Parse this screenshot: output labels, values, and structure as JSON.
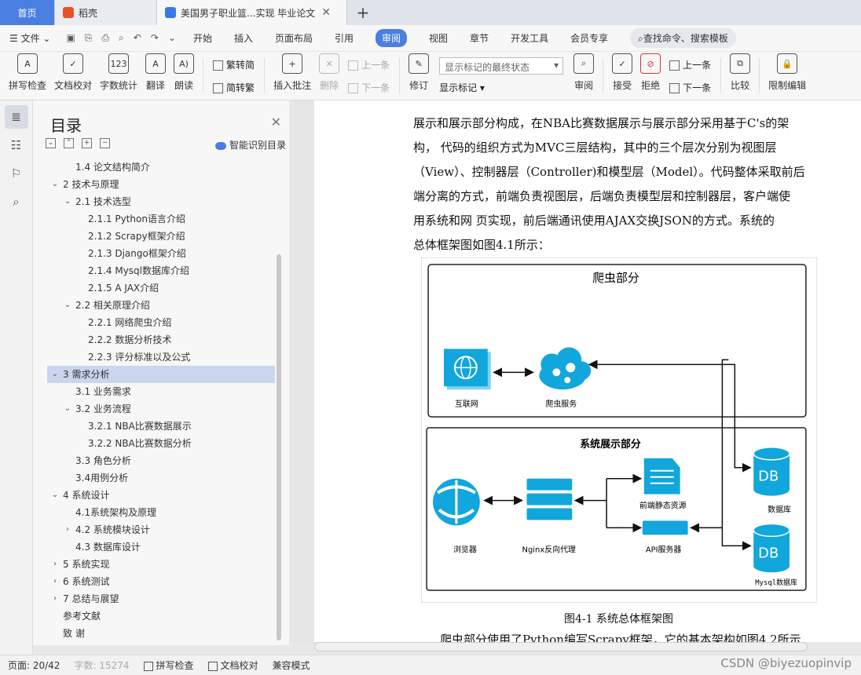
{
  "tabs": {
    "home": "首页",
    "wps": "稻壳",
    "doc": "美国男子职业篮...实现 毕业论文",
    "close": "✕",
    "new": "+"
  },
  "menu": {
    "file": "文件",
    "items": [
      "开始",
      "插入",
      "页面布局",
      "引用",
      "审阅",
      "视图",
      "章节",
      "开发工具",
      "会员专享"
    ],
    "active": "审阅",
    "search": "查找命令、搜索模板"
  },
  "ribbon": {
    "spell": "拼写检查",
    "proof": "文档校对",
    "wordcount": "字数统计",
    "translate": "翻译",
    "read": "朗读",
    "trad": "繁转简",
    "simp": "简转繁",
    "insert_comment": "插入批注",
    "delete": "删除",
    "prev": "上一条",
    "next": "下一条",
    "revise": "修订",
    "markstate": "显示标记的最终状态",
    "showmark": "显示标记",
    "review": "审阅",
    "accept": "接受",
    "reject": "拒绝",
    "prev2": "上一条",
    "next2": "下一条",
    "compare": "比较",
    "restrict": "限制编辑"
  },
  "toc": {
    "title": "目录",
    "smart": "智能识别目录",
    "items": [
      {
        "t": "1.4 论文结构简介",
        "lvl": 2
      },
      {
        "t": "2 技术与原理",
        "lvl": 1,
        "car": "v"
      },
      {
        "t": "2.1 技术选型",
        "lvl": 2,
        "car": "v"
      },
      {
        "t": "2.1.1 Python语言介绍",
        "lvl": 3
      },
      {
        "t": "2.1.2 Scrapy框架介绍",
        "lvl": 3
      },
      {
        "t": "2.1.3 Django框架介绍",
        "lvl": 3
      },
      {
        "t": "2.1.4 Mysql数据库介绍",
        "lvl": 3
      },
      {
        "t": "2.1.5 A JAX介绍",
        "lvl": 3
      },
      {
        "t": "2.2 相关原理介绍",
        "lvl": 2,
        "car": "v"
      },
      {
        "t": "2.2.1 网络爬虫介绍",
        "lvl": 3
      },
      {
        "t": "2.2.2 数据分析技术",
        "lvl": 3
      },
      {
        "t": "2.2.3 评分标准以及公式",
        "lvl": 3
      },
      {
        "t": "3 需求分析",
        "lvl": 1,
        "car": "v",
        "sel": true
      },
      {
        "t": "3.1 业务需求",
        "lvl": 2
      },
      {
        "t": "3.2 业务流程",
        "lvl": 2,
        "car": "v"
      },
      {
        "t": "3.2.1 NBA比赛数据展示",
        "lvl": 3
      },
      {
        "t": "3.2.2 NBA比赛数据分析",
        "lvl": 3
      },
      {
        "t": "3.3 角色分析",
        "lvl": 2
      },
      {
        "t": "3.4用例分析",
        "lvl": 2
      },
      {
        "t": "4 系统设计",
        "lvl": 1,
        "car": "v"
      },
      {
        "t": "4.1系统架构及原理",
        "lvl": 2
      },
      {
        "t": "4.2 系统模块设计",
        "lvl": 2,
        "car": ">"
      },
      {
        "t": "4.3  数据库设计",
        "lvl": 2
      },
      {
        "t": "5 系统实现",
        "lvl": 1,
        "car": ">"
      },
      {
        "t": "6 系统测试",
        "lvl": 1,
        "car": ">"
      },
      {
        "t": "7 总结与展望",
        "lvl": 1,
        "car": ">"
      },
      {
        "t": "参考文献",
        "lvl": 1
      },
      {
        "t": "致  谢",
        "lvl": 1
      }
    ]
  },
  "doc": {
    "lines": [
      "展示和展示部分构成，在NBA比赛数据展示与展示部分采用基于C's的架",
      "构， 代码的组织方式为MVC三层结构，其中的三个层次分别为视图层",
      "（View）、控制器层（Controller)和模型层（Model）。代码整体采取前后",
      "端分离的方式，前端负责视图层，后端负责模型层和控制器层，客户端使",
      "用系统和网  页实现，前后端通讯使用AJAX交换JSON的方式。系统的",
      "总体框架图如图4.1所示："
    ],
    "caption": "图4-1 系统总体框架图",
    "tail": "爬虫部分使用了Python编写Scrapy框架，它的基本架构如图4.2所示"
  },
  "diagram": {
    "crawler_title": "爬虫部分",
    "display_title": "系统展示部分",
    "internet": "互联网",
    "crawler_service": "爬虫服务",
    "browser": "浏览器",
    "nginx": "Nginx反向代理",
    "frontend": "前端静态资源",
    "api": "API服务器",
    "db1": "DB",
    "db1_label": "数据库",
    "db2": "DB",
    "db2_label": "Mysql数据库"
  },
  "status": {
    "page": "页面: 20/42",
    "words": "字数: 15274",
    "spell": "拼写检查",
    "proof": "文档校对",
    "compat": "兼容模式",
    "watermark": "CSDN @biyezuopinvip"
  }
}
